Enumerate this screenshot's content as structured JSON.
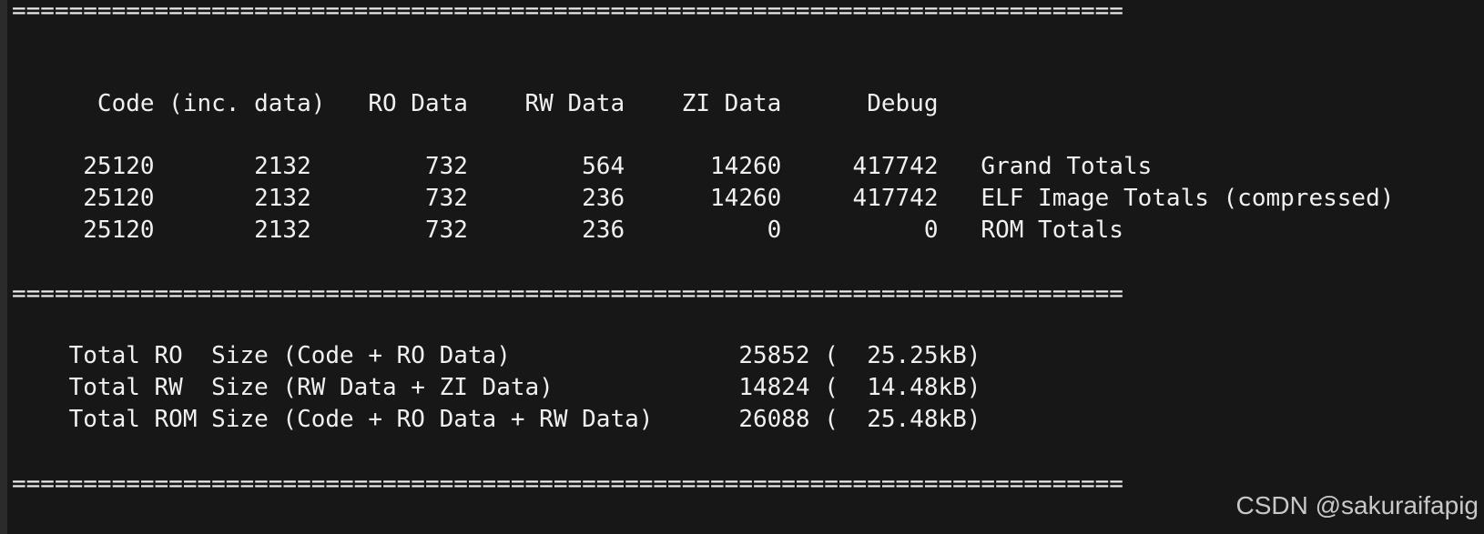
{
  "terminal": {
    "separator_top": "==============================================================================",
    "header_row": "      Code (inc. data)   RO Data    RW Data    ZI Data      Debug",
    "totals": [
      "     25120       2132        732        564      14260     417742   Grand Totals",
      "     25120       2132        732        236      14260     417742   ELF Image Totals (compressed)",
      "     25120       2132        732        236          0          0   ROM Totals"
    ],
    "separator_mid": "==============================================================================",
    "sizes": [
      "    Total RO  Size (Code + RO Data)                25852 (  25.25kB)",
      "    Total RW  Size (RW Data + ZI Data)             14824 (  14.48kB)",
      "    Total ROM Size (Code + RO Data + RW Data)      26088 (  25.48kB)"
    ],
    "separator_bottom": "=============================================================================="
  },
  "watermark": "CSDN @sakuraifapig",
  "colors": {
    "background": "#171717",
    "text": "#f0f0f0",
    "watermark": "#c8c8c8"
  }
}
